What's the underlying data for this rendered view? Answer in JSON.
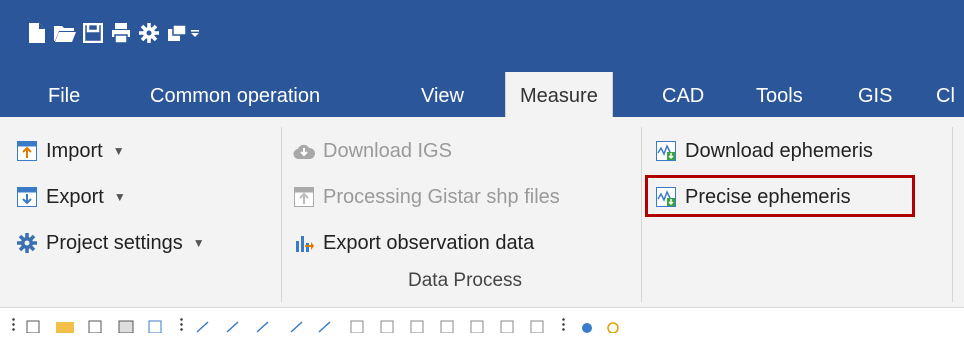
{
  "quick_access": {
    "icons": [
      "new-file-icon",
      "open-folder-icon",
      "save-icon",
      "print-icon",
      "settings-gear-icon",
      "windows-icon",
      "customize-dropdown-icon"
    ]
  },
  "tabs": [
    {
      "label": "File"
    },
    {
      "label": "Common operation"
    },
    {
      "label": "View"
    },
    {
      "label": "Measure",
      "active": true
    },
    {
      "label": "CAD"
    },
    {
      "label": "Tools"
    },
    {
      "label": "GIS"
    },
    {
      "label": "Cl"
    }
  ],
  "ribbon": {
    "col1": {
      "import": "Import",
      "export": "Export",
      "project_settings": "Project settings"
    },
    "col2": {
      "download_igs": "Download IGS",
      "processing_gistar": "Processing Gistar shp files",
      "export_observation": "Export observation data"
    },
    "col3": {
      "download_ephemeris": "Download ephemeris",
      "precise_ephemeris": "Precise ephemeris"
    },
    "group_label": "Data Process"
  },
  "colors": {
    "title_bar": "#2b579a",
    "ribbon_bg": "#f3f3f3",
    "highlight_border": "#b00000"
  }
}
